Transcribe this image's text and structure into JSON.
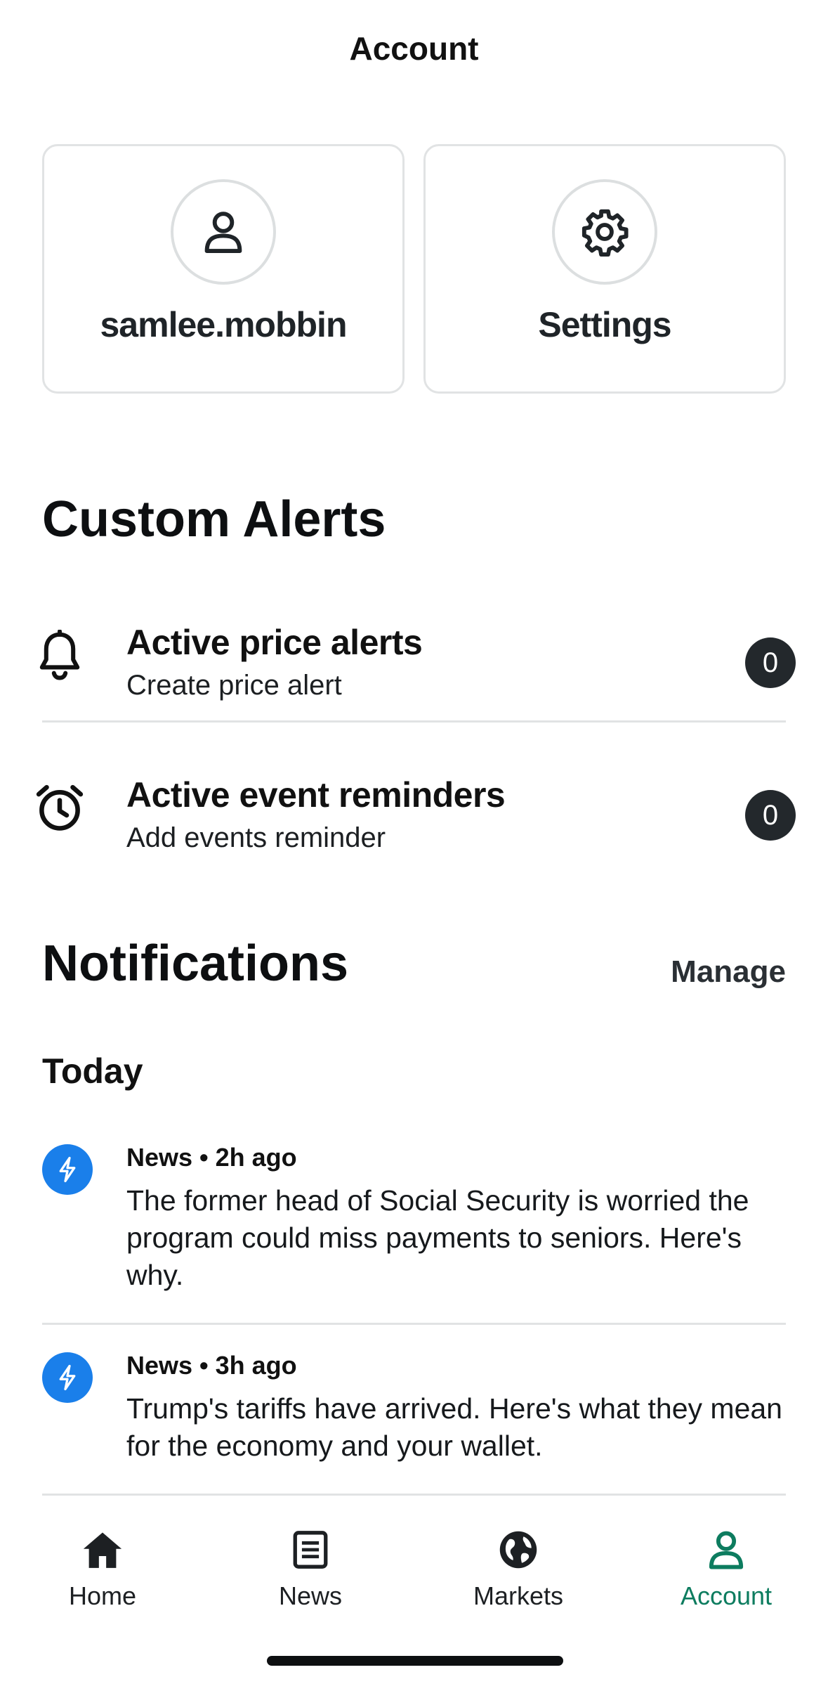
{
  "header": {
    "title": "Account"
  },
  "cards": {
    "profile": {
      "label": "samlee.mobbin",
      "icon": "person-icon"
    },
    "settings": {
      "label": "Settings",
      "icon": "gear-icon"
    }
  },
  "custom_alerts": {
    "title": "Custom Alerts",
    "items": [
      {
        "title": "Active price alerts",
        "subtitle": "Create price alert",
        "count": "0",
        "icon": "bell-icon"
      },
      {
        "title": "Active event reminders",
        "subtitle": "Add events reminder",
        "count": "0",
        "icon": "alarm-clock-icon"
      }
    ]
  },
  "notifications": {
    "title": "Notifications",
    "manage_label": "Manage",
    "group_label": "Today",
    "items": [
      {
        "meta": "News • 2h ago",
        "headline": "The former head of Social Security is worried the program could miss payments to seniors. Here's why.",
        "icon": "lightning-icon"
      },
      {
        "meta": "News • 3h ago",
        "headline": "Trump's tariffs have arrived. Here's what they mean for the economy and your wallet.",
        "icon": "lightning-icon"
      }
    ]
  },
  "tabbar": {
    "items": [
      {
        "label": "Home",
        "icon": "home-icon"
      },
      {
        "label": "News",
        "icon": "news-icon"
      },
      {
        "label": "Markets",
        "icon": "globe-icon"
      },
      {
        "label": "Account",
        "icon": "person-icon",
        "active": true
      }
    ]
  },
  "colors": {
    "accent": "#0d7c5f",
    "news_badge": "#1a7fea",
    "count_badge": "#23282c"
  }
}
